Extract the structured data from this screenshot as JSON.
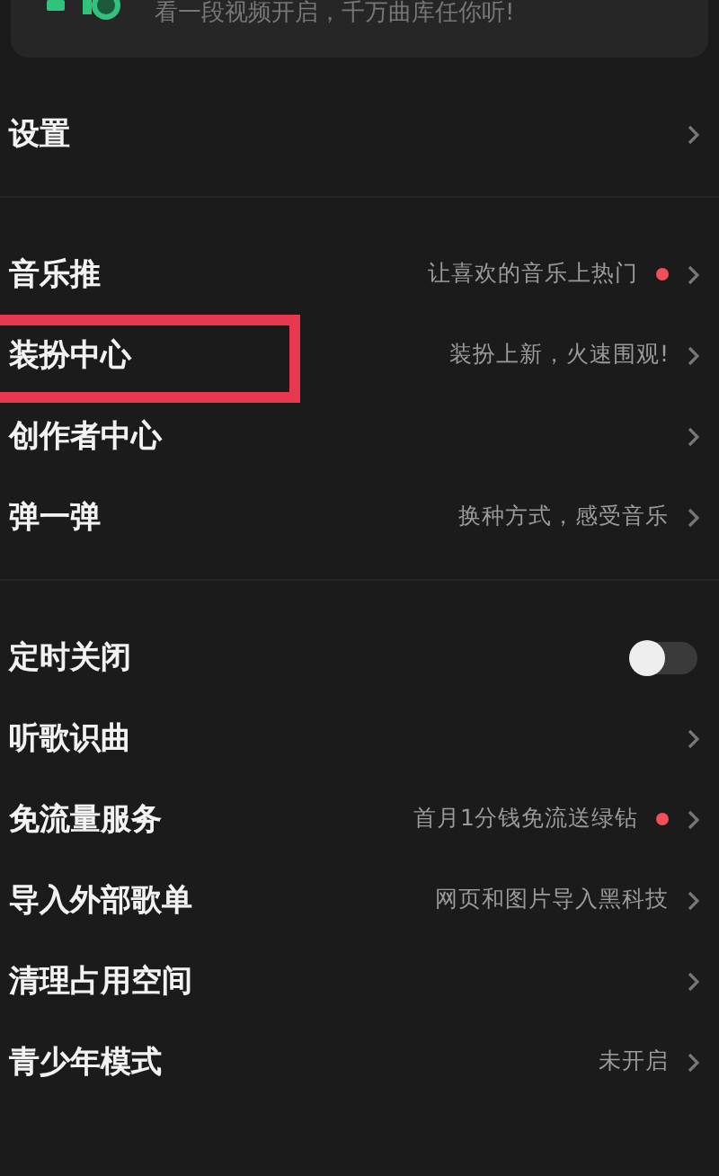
{
  "banner": {
    "text": "看一段视频开启，千万曲库任你听!"
  },
  "sections": [
    {
      "rows": [
        {
          "kind": "link",
          "title": "设置",
          "highlighted": false
        }
      ]
    },
    {
      "rows": [
        {
          "kind": "link",
          "title": "音乐推",
          "hint": "让喜欢的音乐上热门",
          "dot": true,
          "highlighted": false
        },
        {
          "kind": "link",
          "title": "装扮中心",
          "hint": "装扮上新，火速围观!",
          "dot": false,
          "highlighted": true
        },
        {
          "kind": "link",
          "title": "创作者中心",
          "highlighted": false
        },
        {
          "kind": "link",
          "title": "弹一弹",
          "hint": "换种方式，感受音乐",
          "dot": false,
          "highlighted": false
        }
      ]
    },
    {
      "rows": [
        {
          "kind": "toggle",
          "title": "定时关闭",
          "on": false,
          "highlighted": false
        },
        {
          "kind": "link",
          "title": "听歌识曲",
          "highlighted": false
        },
        {
          "kind": "link",
          "title": "免流量服务",
          "hint": "首月1分钱免流送绿钻",
          "dot": true,
          "highlighted": false
        },
        {
          "kind": "link",
          "title": "导入外部歌单",
          "hint": "网页和图片导入黑科技",
          "dot": false,
          "highlighted": false
        },
        {
          "kind": "link",
          "title": "清理占用空间",
          "highlighted": false
        },
        {
          "kind": "link",
          "title": "青少年模式",
          "hint": "未开启",
          "dot": false,
          "highlighted": false
        }
      ]
    }
  ]
}
